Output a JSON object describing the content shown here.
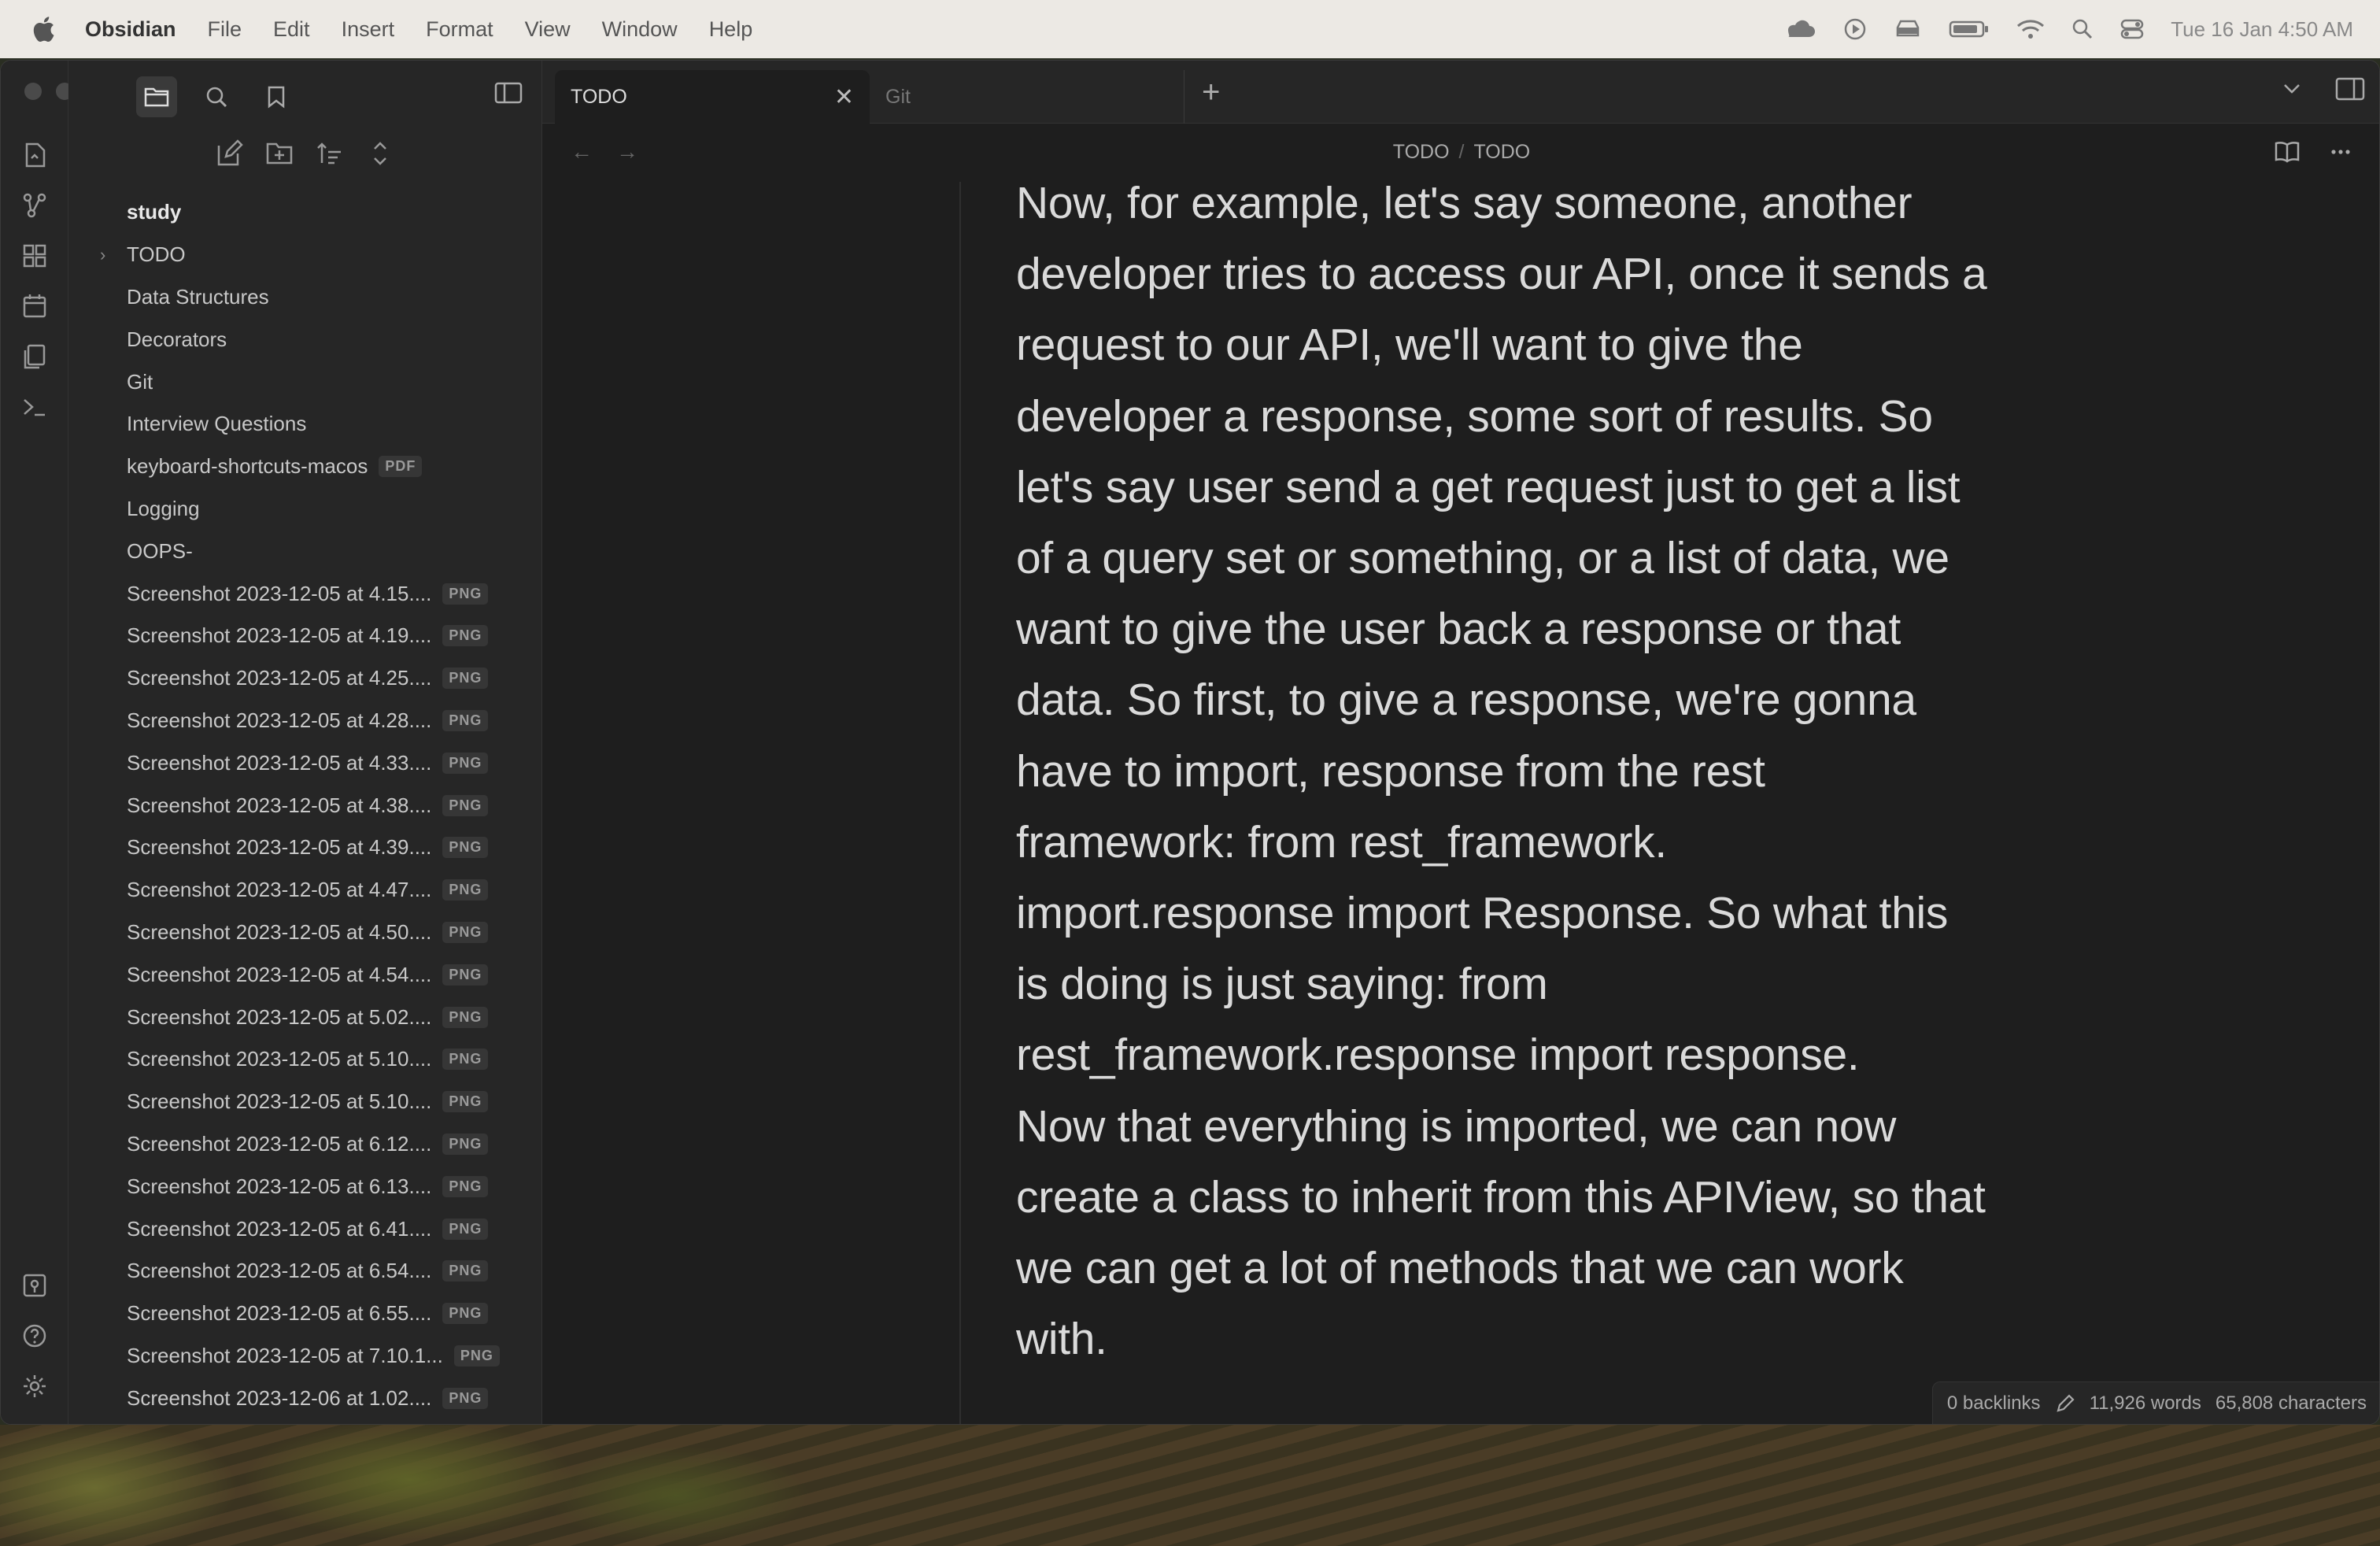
{
  "menubar": {
    "app_name": "Obsidian",
    "menus": [
      "File",
      "Edit",
      "Insert",
      "Format",
      "View",
      "Window",
      "Help"
    ],
    "clock": "Tue 16 Jan  4:50 AM"
  },
  "tabs": [
    {
      "label": "TODO",
      "active": true
    },
    {
      "label": "Git",
      "active": false
    }
  ],
  "breadcrumb": {
    "folder": "TODO",
    "separator": "/",
    "file": "TODO"
  },
  "file_tree": [
    {
      "name": "study",
      "type": "root"
    },
    {
      "name": "TODO",
      "type": "folder"
    },
    {
      "name": "Data Structures",
      "type": "file"
    },
    {
      "name": "Decorators",
      "type": "file"
    },
    {
      "name": "Git",
      "type": "file"
    },
    {
      "name": "Interview Questions",
      "type": "file"
    },
    {
      "name": "keyboard-shortcuts-macos",
      "type": "file",
      "ext": "PDF"
    },
    {
      "name": "Logging",
      "type": "file"
    },
    {
      "name": "OOPS-",
      "type": "file"
    },
    {
      "name": "Screenshot 2023-12-05 at 4.15....",
      "type": "file",
      "ext": "PNG"
    },
    {
      "name": "Screenshot 2023-12-05 at 4.19....",
      "type": "file",
      "ext": "PNG"
    },
    {
      "name": "Screenshot 2023-12-05 at 4.25....",
      "type": "file",
      "ext": "PNG"
    },
    {
      "name": "Screenshot 2023-12-05 at 4.28....",
      "type": "file",
      "ext": "PNG"
    },
    {
      "name": "Screenshot 2023-12-05 at 4.33....",
      "type": "file",
      "ext": "PNG"
    },
    {
      "name": "Screenshot 2023-12-05 at 4.38....",
      "type": "file",
      "ext": "PNG"
    },
    {
      "name": "Screenshot 2023-12-05 at 4.39....",
      "type": "file",
      "ext": "PNG"
    },
    {
      "name": "Screenshot 2023-12-05 at 4.47....",
      "type": "file",
      "ext": "PNG"
    },
    {
      "name": "Screenshot 2023-12-05 at 4.50....",
      "type": "file",
      "ext": "PNG"
    },
    {
      "name": "Screenshot 2023-12-05 at 4.54....",
      "type": "file",
      "ext": "PNG"
    },
    {
      "name": "Screenshot 2023-12-05 at 5.02....",
      "type": "file",
      "ext": "PNG"
    },
    {
      "name": "Screenshot 2023-12-05 at 5.10....",
      "type": "file",
      "ext": "PNG"
    },
    {
      "name": "Screenshot 2023-12-05 at 5.10....",
      "type": "file",
      "ext": "PNG"
    },
    {
      "name": "Screenshot 2023-12-05 at 6.12....",
      "type": "file",
      "ext": "PNG"
    },
    {
      "name": "Screenshot 2023-12-05 at 6.13....",
      "type": "file",
      "ext": "PNG"
    },
    {
      "name": "Screenshot 2023-12-05 at 6.41....",
      "type": "file",
      "ext": "PNG"
    },
    {
      "name": "Screenshot 2023-12-05 at 6.54....",
      "type": "file",
      "ext": "PNG"
    },
    {
      "name": "Screenshot 2023-12-05 at 6.55....",
      "type": "file",
      "ext": "PNG"
    },
    {
      "name": "Screenshot 2023-12-05 at 7.10.1...",
      "type": "file",
      "ext": "PNG"
    },
    {
      "name": "Screenshot 2023-12-06 at 1.02....",
      "type": "file",
      "ext": "PNG"
    }
  ],
  "editor": {
    "lines": [
      "Now, for example, let's say someone, another",
      "developer tries to access our API, once it sends a",
      "request to our API, we'll want to give the",
      "developer a response, some sort of results. So",
      "let's say user send a get request just to get a list",
      "of a query set or something, or a list of data, we",
      "want to give the user back a response or that",
      "data. So first, to give a response, we're gonna",
      "have to import, response from the rest",
      "framework: from rest_framework.",
      "import.response import Response. So what this",
      "is doing is just saying: from",
      "rest_framework.response import response.",
      "Now that everything is imported, we can now",
      "create a class to inherit from this APIView, so that",
      "we can get a lot of methods that we can work",
      "with."
    ]
  },
  "status": {
    "backlinks": "0 backlinks",
    "words": "11,926 words",
    "characters": "65,808 characters"
  }
}
